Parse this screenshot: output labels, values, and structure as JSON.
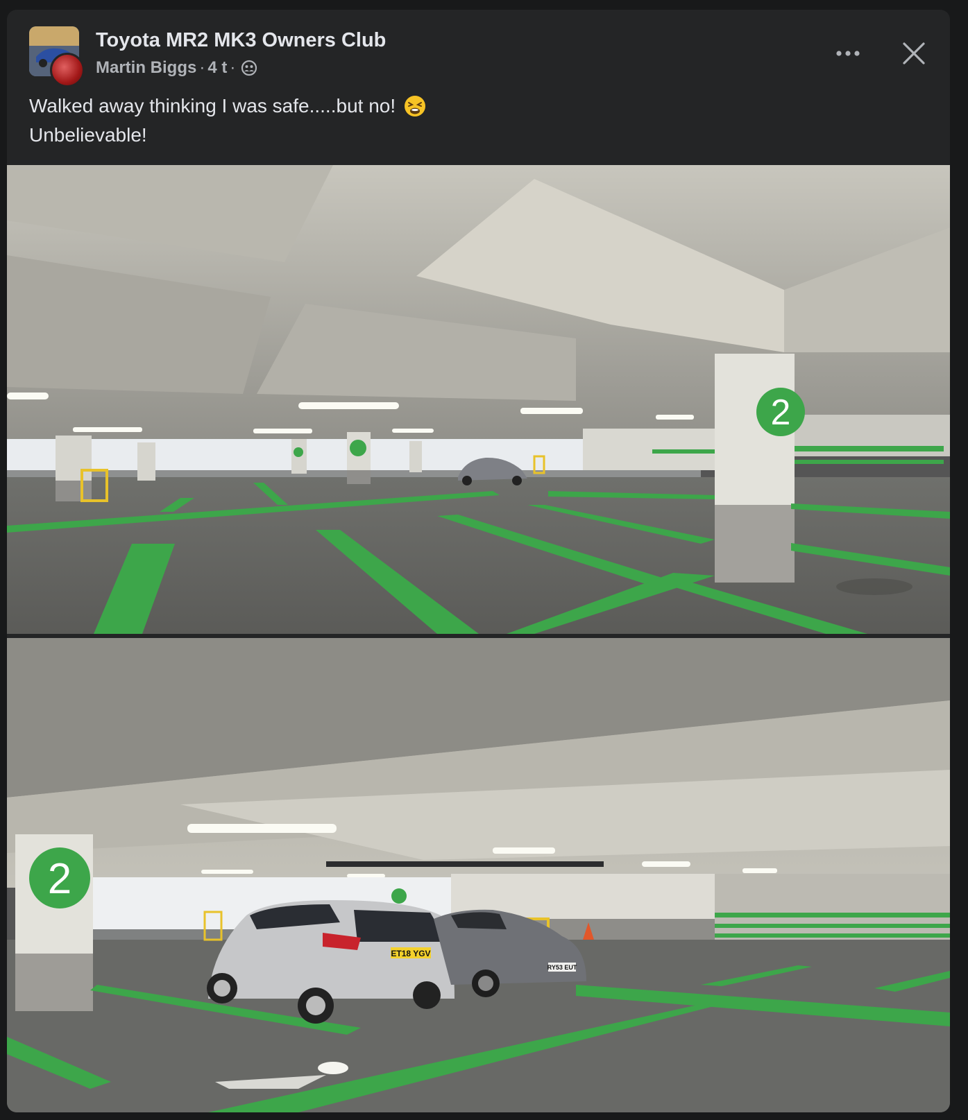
{
  "post": {
    "group_name": "Toyota MR2 MK3 Owners Club",
    "author": "Martin Biggs",
    "separator": "·",
    "time": "4 t",
    "privacy_icon": "group-members-icon",
    "more_icon": "more-horizontal-icon",
    "close_icon": "close-icon",
    "text_line_1": "Walked away thinking I was safe.....but no!",
    "text_emoji": "weary-face-emoji",
    "text_line_2": "Unbelievable!"
  },
  "photos": [
    {
      "description_name": "car-park-photo-1",
      "pillar_number": "2"
    },
    {
      "description_name": "car-park-photo-2",
      "pillar_number": "2",
      "plate_left": "ET18 YGV",
      "plate_right": "RY53 EUT"
    }
  ],
  "colors": {
    "background": "#18191a",
    "card": "#242526",
    "primary_text": "#e4e6eb",
    "secondary_text": "#b0b3b8",
    "marking_green": "#3da64a"
  }
}
